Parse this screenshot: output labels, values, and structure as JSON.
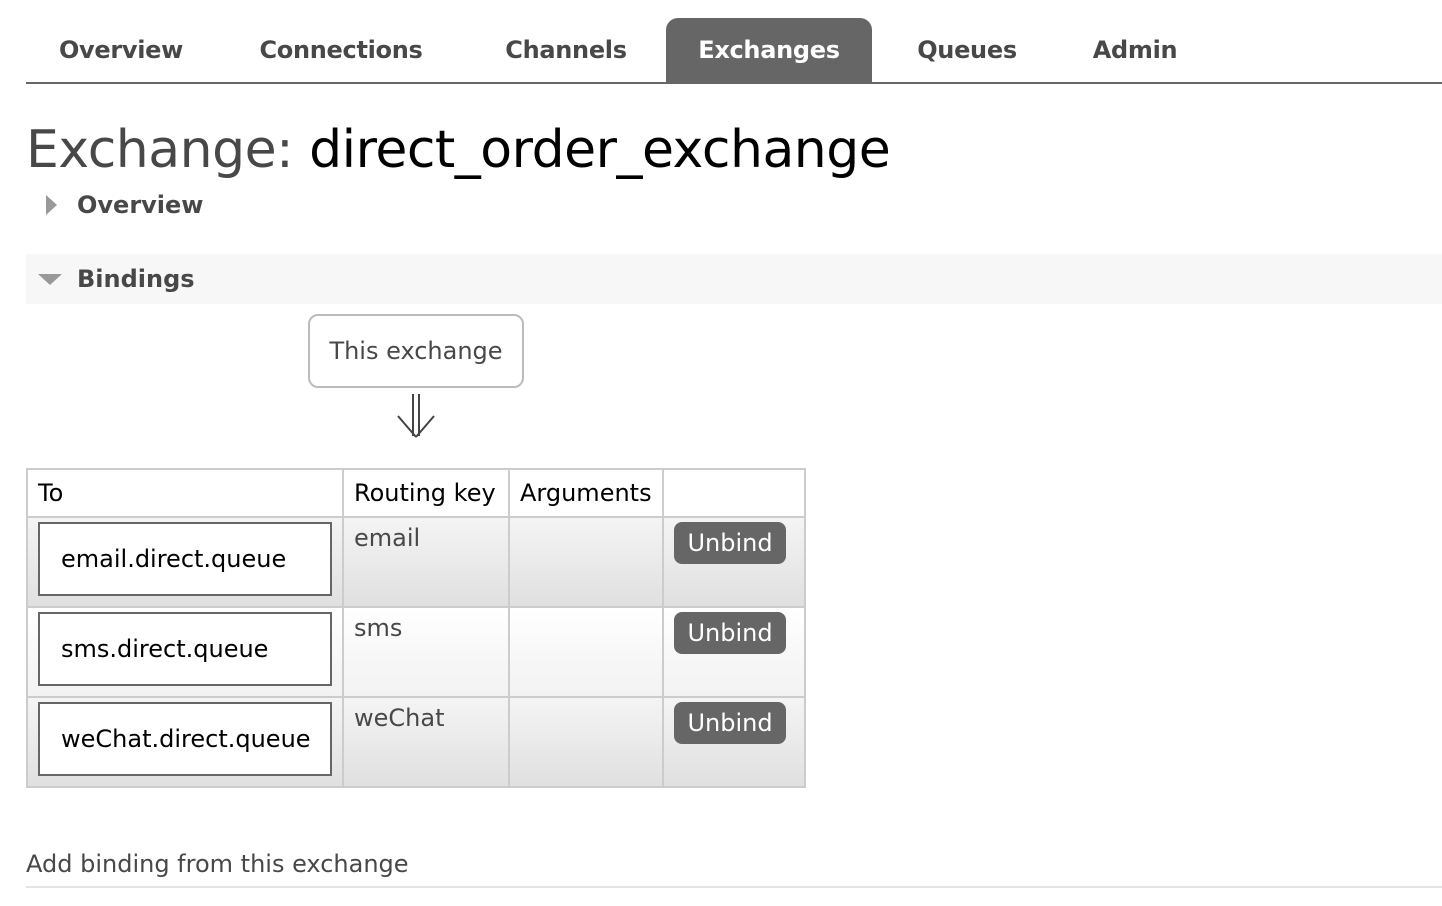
{
  "nav": {
    "tabs": [
      {
        "label": "Overview",
        "active": false
      },
      {
        "label": "Connections",
        "active": false
      },
      {
        "label": "Channels",
        "active": false
      },
      {
        "label": "Exchanges",
        "active": true
      },
      {
        "label": "Queues",
        "active": false
      },
      {
        "label": "Admin",
        "active": false
      }
    ]
  },
  "page": {
    "title_label": "Exchange:",
    "exchange_name": "direct_order_exchange"
  },
  "sections": {
    "overview": {
      "label": "Overview",
      "expanded": false,
      "icon": "triangle-right-icon"
    },
    "bindings": {
      "label": "Bindings",
      "expanded": true,
      "icon": "triangle-down-icon"
    }
  },
  "bindings": {
    "source_label": "This exchange",
    "arrow_icon": "double-down-arrow-icon",
    "columns": [
      "To",
      "Routing key",
      "Arguments",
      ""
    ],
    "rows": [
      {
        "to": "email.direct.queue",
        "routing_key": "email",
        "arguments": "",
        "action": "Unbind"
      },
      {
        "to": "sms.direct.queue",
        "routing_key": "sms",
        "arguments": "",
        "action": "Unbind"
      },
      {
        "to": "weChat.direct.queue",
        "routing_key": "weChat",
        "arguments": "",
        "action": "Unbind"
      }
    ]
  },
  "add_binding": {
    "label": "Add binding from this exchange"
  },
  "colors": {
    "accent": "#666666",
    "text": "#484848",
    "section_bg": "#f7f7f7"
  }
}
